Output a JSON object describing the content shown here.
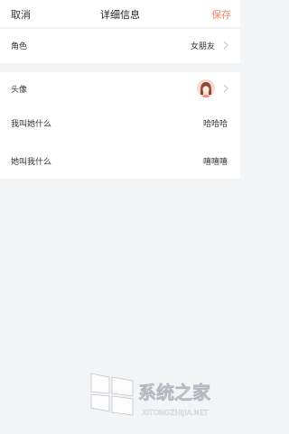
{
  "header": {
    "cancel_label": "取消",
    "title": "详细信息",
    "save_label": "保存"
  },
  "role_row": {
    "label": "角色",
    "value": "女朋友"
  },
  "avatar_row": {
    "label": "头像"
  },
  "call_her_row": {
    "label": "我叫她什么",
    "value": "哈哈哈"
  },
  "she_calls_me_row": {
    "label": "她叫我什么",
    "value": "嘻嘻嘻"
  },
  "watermark": {
    "text": "系统之家",
    "url": "XITONGZHIJIA.NET"
  },
  "colors": {
    "accent": "#f08a6a",
    "background": "#f3f4f6",
    "card": "#ffffff"
  }
}
